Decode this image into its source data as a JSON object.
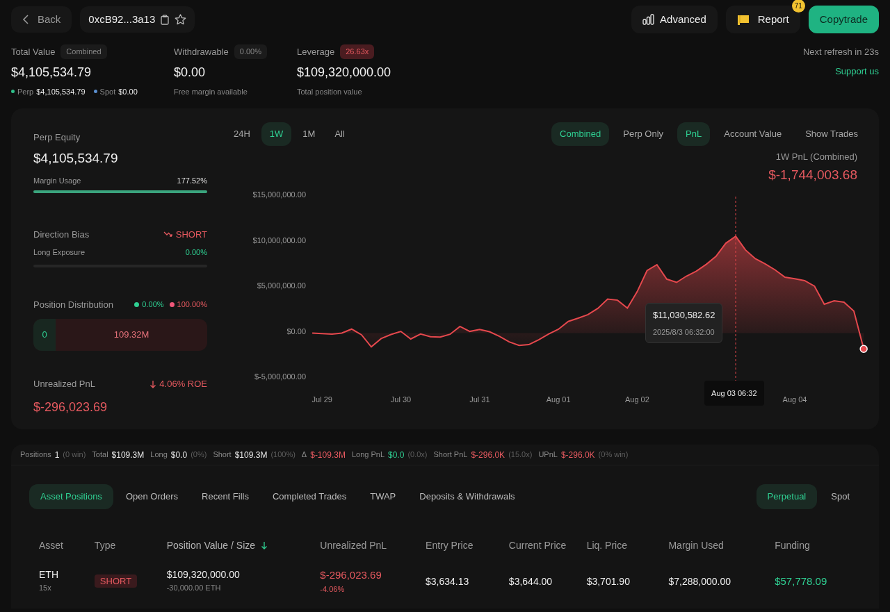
{
  "header": {
    "back_label": "Back",
    "address": "0xcB92...3a13",
    "advanced_label": "Advanced",
    "report_label": "Report",
    "report_badge": "71",
    "copytrade_label": "Copytrade",
    "next_refresh": "Next refresh in 23s",
    "support_link": "Support us"
  },
  "stats": [
    {
      "kind": "total",
      "label": "Total Value",
      "badge": "Combined",
      "alert": false,
      "value": "$4,105,534.79",
      "parts": [
        {
          "label": "Perp",
          "value": "$4,105,534.79",
          "color": "#2fbf8a"
        },
        {
          "label": "Spot",
          "value": "$0.00",
          "color": "#5b8fd0"
        }
      ]
    },
    {
      "kind": "plain",
      "label": "Withdrawable",
      "badge": "0.00%",
      "alert": false,
      "value": "$0.00",
      "caption": "Free margin available"
    },
    {
      "kind": "plain",
      "label": "Leverage",
      "badge": "26.63x",
      "alert": true,
      "value": "$109,320,000.00",
      "caption": "Total position value"
    }
  ],
  "overview": {
    "perp_equity": {
      "label": "Perp Equity",
      "value": "$4,105,534.79"
    },
    "margin_usage": {
      "label": "Margin Usage",
      "reading": "177.52%",
      "level": 1
    },
    "direction_bias": {
      "label": "Direction Bias",
      "value": "SHORT"
    },
    "long_exposure": {
      "label": "Long Exposure",
      "reading": "0.00%",
      "level": 0
    },
    "position_distribution": {
      "label": "Position Distribution",
      "long_pct": "0.00%",
      "short_pct": "100.00%",
      "long_value": "0",
      "short_value": "109.32M",
      "level": 0
    },
    "unrealized_pnl": {
      "label": "Unrealized PnL",
      "roe": "4.06% ROE",
      "value": "$-296,023.69"
    }
  },
  "chart_panel": {
    "range_tabs": [
      {
        "label": "24H",
        "selected": false
      },
      {
        "label": "1W",
        "selected": true
      },
      {
        "label": "1M",
        "selected": false
      },
      {
        "label": "All",
        "selected": false
      }
    ],
    "scope_tabs": [
      {
        "label": "Combined",
        "selected": true
      },
      {
        "label": "Perp Only",
        "selected": false
      }
    ],
    "metric_tabs": [
      {
        "label": "PnL",
        "selected": true
      },
      {
        "label": "Account Value",
        "selected": false
      }
    ],
    "show_trades": "Show Trades",
    "summary_label": "1W PnL (Combined)",
    "summary_value": "$-1,744,003.68",
    "tooltip": {
      "value": "$11,030,582.62",
      "time": "2025/8/3 06:32:00"
    },
    "crosshair_label": "Aug 03 06:32",
    "chart_data": {
      "type": "area",
      "categories": [
        null,
        "Jul 29",
        null,
        null,
        null,
        null,
        null,
        null,
        null,
        "Jul 30",
        null,
        null,
        null,
        null,
        null,
        null,
        null,
        "Jul 31",
        null,
        null,
        null,
        null,
        null,
        null,
        null,
        "Aug 01",
        null,
        null,
        null,
        null,
        null,
        null,
        null,
        "Aug 02",
        null,
        null,
        null,
        null,
        null,
        null,
        null,
        null,
        null,
        null,
        null,
        null,
        null,
        null,
        null,
        "Aug 04",
        null,
        null,
        null,
        null,
        null,
        null,
        null
      ],
      "series": [
        {
          "color": "#e5484d",
          "values": [
            0,
            -60000,
            -120000,
            10000,
            440000,
            -180000,
            -1510000,
            -600000,
            -150000,
            190000,
            -650000,
            -100000,
            -400000,
            -440000,
            -130000,
            730000,
            180000,
            400000,
            150000,
            -360000,
            -970000,
            -1360000,
            -1270000,
            -730000,
            -100000,
            420000,
            1280000,
            1640000,
            2030000,
            2720000,
            3730000,
            3620000,
            2750000,
            4560000,
            6870000,
            7520000,
            5930000,
            5570000,
            6260000,
            6800000,
            7550000,
            8430000,
            9880000,
            10630000,
            9130000,
            8170000,
            7610000,
            6950000,
            6140000,
            5970000,
            5770000,
            5150000,
            3170000,
            3540000,
            3400000,
            2420000,
            -1740000
          ]
        }
      ],
      "ylim": [
        -5000000,
        15000000
      ],
      "yticks": [
        {
          "value": 15000000,
          "label": "$15,000,000.00"
        },
        {
          "value": 10000000,
          "label": "$10,000,000.00"
        },
        {
          "value": 5000000,
          "label": "$5,000,000.00"
        },
        {
          "value": 0,
          "label": "$0.00"
        },
        {
          "value": -5000000,
          "label": "$-5,000,000.00"
        }
      ]
    }
  },
  "positions_summary": [
    {
      "label": "Positions",
      "value": "1",
      "note": "(0 win)",
      "color": "#e8e8e8"
    },
    {
      "label": "Total",
      "value": "$109.3M",
      "color": "#e8e8e8"
    },
    {
      "label": "Long",
      "value": "$0.0",
      "note": "(0%)",
      "color": "#e8e8e8"
    },
    {
      "label": "Short",
      "value": "$109.3M",
      "note": "(100%)",
      "color": "#e8e8e8"
    },
    {
      "label": "Δ",
      "value": "$-109.3M",
      "color": "#e5595f"
    },
    {
      "label": "Long PnL",
      "value": "$0.0",
      "note": "(0.0x)",
      "color": "#2fcf92"
    },
    {
      "label": "Short PnL",
      "value": "$-296.0K",
      "note": "(15.0x)",
      "color": "#e5595f"
    },
    {
      "label": "UPnL",
      "value": "$-296.0K",
      "note": "(0% win)",
      "color": "#e5595f"
    }
  ],
  "tabs": [
    {
      "label": "Asset Positions",
      "selected": true
    },
    {
      "label": "Open Orders",
      "selected": false
    },
    {
      "label": "Recent Fills",
      "selected": false
    },
    {
      "label": "Completed Trades",
      "selected": false
    },
    {
      "label": "TWAP",
      "selected": false
    },
    {
      "label": "Deposits & Withdrawals",
      "selected": false
    }
  ],
  "market_tabs": [
    {
      "label": "Perpetual",
      "selected": true
    },
    {
      "label": "Spot",
      "selected": false
    }
  ],
  "table": {
    "columns": [
      {
        "label": "Asset",
        "sorted": false
      },
      {
        "label": "Type",
        "sorted": false
      },
      {
        "label": "Position Value / Size",
        "sorted": true
      },
      {
        "label": "Unrealized PnL",
        "sorted": false
      },
      {
        "label": "Entry Price",
        "sorted": false
      },
      {
        "label": "Current Price",
        "sorted": false
      },
      {
        "label": "Liq. Price",
        "sorted": false
      },
      {
        "label": "Margin Used",
        "sorted": false
      },
      {
        "label": "Funding",
        "sorted": false
      }
    ],
    "rows": [
      {
        "asset": "ETH",
        "leverage": "15x",
        "type": "SHORT",
        "value": "$109,320,000.00",
        "size": "-30,000.00 ETH",
        "pnl": "$-296,023.69",
        "pnl_pct": "-4.06%",
        "entry": "$3,634.13",
        "current": "$3,644.00",
        "liq": "$3,701.90",
        "margin": "$7,288,000.00",
        "funding": "$57,778.09"
      }
    ]
  }
}
